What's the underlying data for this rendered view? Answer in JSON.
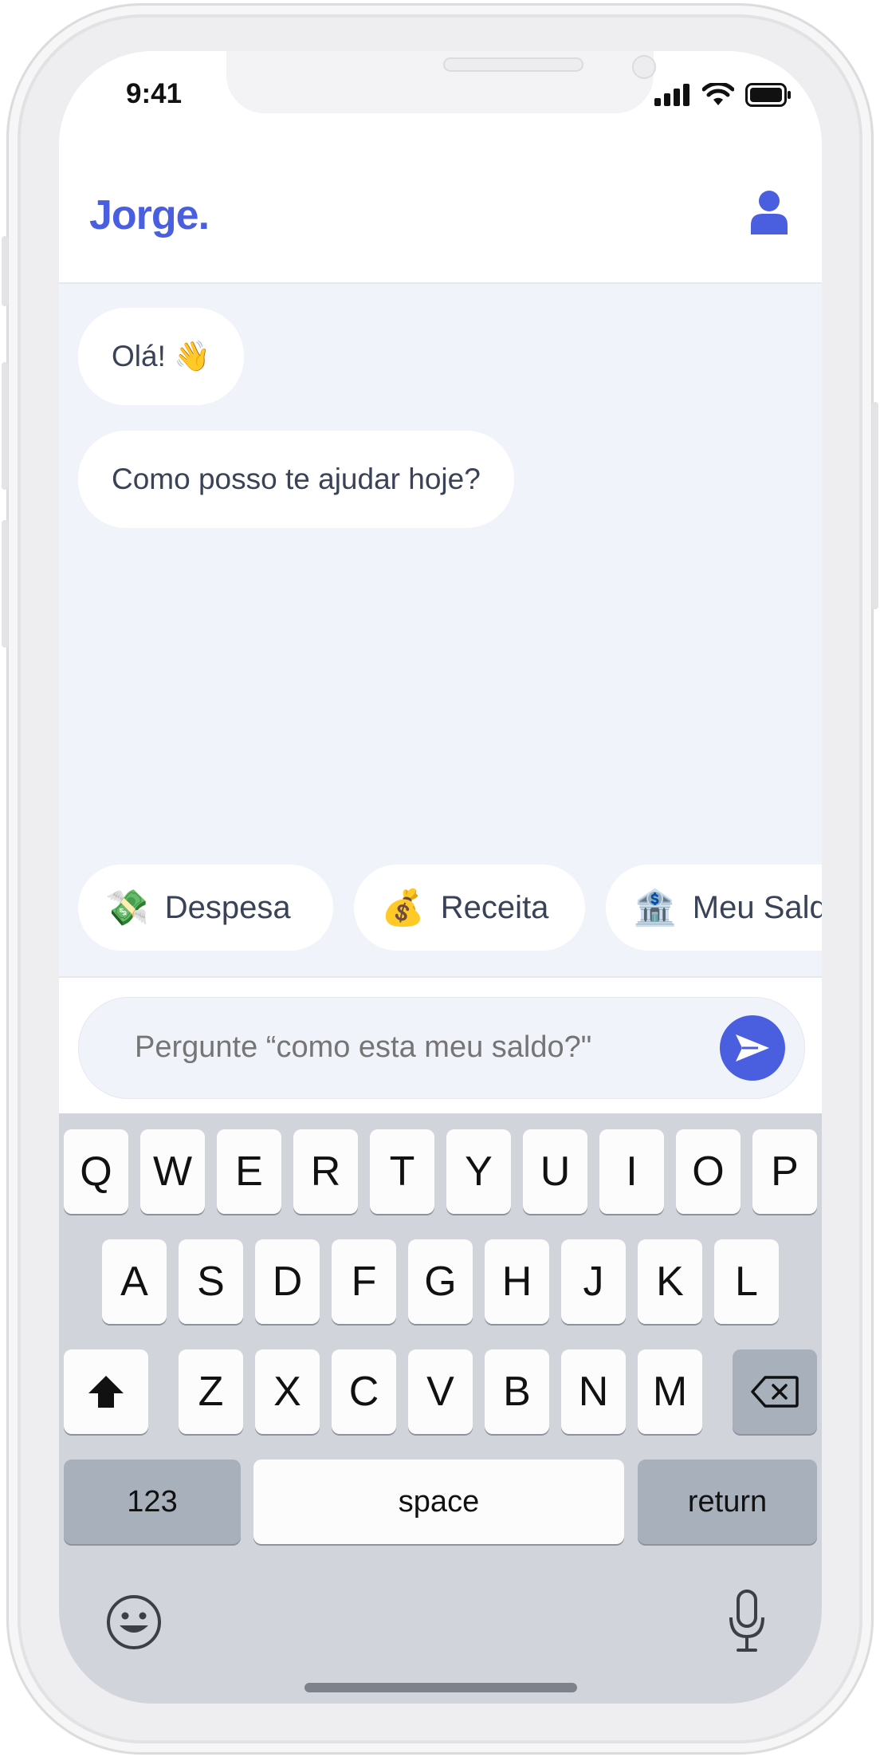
{
  "status_bar": {
    "time": "9:41"
  },
  "header": {
    "brand": "Jorge."
  },
  "chat": {
    "messages": [
      {
        "text": "Olá! 👋"
      },
      {
        "text": "Como posso te ajudar hoje?"
      }
    ]
  },
  "quick_actions": [
    {
      "emoji": "💸",
      "label": "Despesa"
    },
    {
      "emoji": "💰",
      "label": "Receita"
    },
    {
      "emoji": "🏦",
      "label": "Meu Saldo"
    }
  ],
  "composer": {
    "placeholder": "Pergunte “como esta meu saldo?\""
  },
  "keyboard": {
    "row1": [
      "Q",
      "W",
      "E",
      "R",
      "T",
      "Y",
      "U",
      "I",
      "O",
      "P"
    ],
    "row2": [
      "A",
      "S",
      "D",
      "F",
      "G",
      "H",
      "J",
      "K",
      "L"
    ],
    "row3": [
      "Z",
      "X",
      "C",
      "V",
      "B",
      "N",
      "M"
    ],
    "numbers_label": "123",
    "space_label": "space",
    "return_label": "return"
  },
  "colors": {
    "accent": "#4a5fe0",
    "chat_bg": "#f1f3fb",
    "text": "#3a4258",
    "placeholder": "#8a93a8"
  },
  "icons": [
    "profile-icon",
    "signal-icon",
    "wifi-icon",
    "battery-icon",
    "send-icon",
    "shift-icon",
    "backspace-icon",
    "emoji-icon",
    "microphone-icon"
  ]
}
